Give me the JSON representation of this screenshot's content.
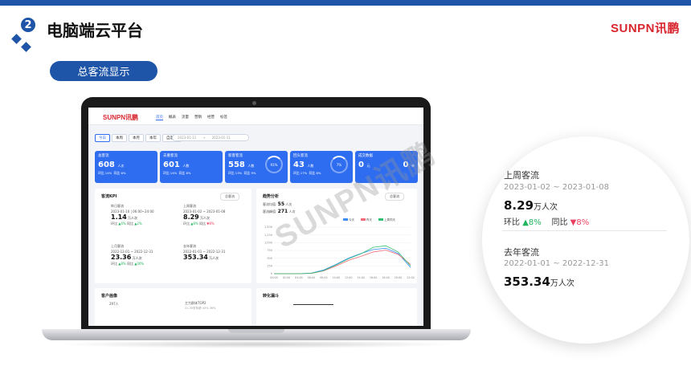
{
  "header": {
    "section_number": "2",
    "title": "电脑端云平台",
    "brand": "SUNPN讯鹏"
  },
  "section_pill": "总客流显示",
  "app": {
    "logo": "SUNPN讯鹏",
    "nav": [
      "首页",
      "概表",
      "流量",
      "营销",
      "经营",
      "标签"
    ],
    "filters": [
      "今日",
      "本周",
      "本月",
      "本年",
      "自定义"
    ],
    "date_range": {
      "start": "2023-01-11",
      "end": "2023-01-11"
    },
    "cards": [
      {
        "title": "总客流",
        "value": "608",
        "unit": "人次",
        "huanbi": "环比 14%",
        "tongbi": "同比 6%"
      },
      {
        "title": "去重客流",
        "value": "601",
        "unit": "人数",
        "huanbi": "环比 14%",
        "tongbi": "同比 8%"
      },
      {
        "title": "新客客流",
        "value": "558",
        "unit": "人数",
        "ring": "91%",
        "huanbi": "环比 13%",
        "tongbi": "同比 9%"
      },
      {
        "title": "回头客流",
        "value": "43",
        "unit": "人数",
        "ring": "7%",
        "huanbi": "环比 17%",
        "tongbi": "同比 8%"
      },
      {
        "title": "成交数据",
        "value": "0",
        "unit": "元",
        "value2": "0",
        "unit2": "单"
      }
    ],
    "kpi": {
      "title": "客流KPI",
      "select": "总客流",
      "blocks": [
        {
          "label": "昨日客流",
          "date": "2023-01-10 | 06:00~24:00",
          "value": "1.14",
          "unit": "万人次",
          "huanbi": "▲4%",
          "tongbi": "▲2%"
        },
        {
          "label": "上周客流",
          "date": "2023-01-02 ~ 2023-01-08",
          "value": "8.29",
          "unit": "万人次",
          "huanbi": "▲8%",
          "tongbi": "▼8%"
        },
        {
          "label": "上月客流",
          "date": "2022-12-01 ~ 2022-12-31",
          "value": "23.36",
          "unit": "万人次",
          "huanbi": "▲8%",
          "tongbi": "▲00%"
        },
        {
          "label": "去年客流",
          "date": "2022-01-01 ~ 2022-12-31",
          "value": "353.34",
          "unit": "万人次"
        }
      ]
    },
    "trend": {
      "title": "趋势分析",
      "select": "总客流",
      "stat1_label": "客流均值:",
      "stat1_value": "55",
      "stat1_unit": "人次",
      "stat2_label": "客流峰值:",
      "stat2_value": "271",
      "stat2_unit": "人次",
      "legend": [
        "今天",
        "昨天",
        "上周同天"
      ],
      "colors": [
        "#3a8ef5",
        "#f06a78",
        "#2fbf71"
      ]
    },
    "bottom": {
      "portrait": "客户画像",
      "portrait_value": "297人",
      "top2": "主力群体TOP2",
      "top2_sub": "21-30岁年龄 43% 36%",
      "convert": "转化漏斗"
    }
  },
  "chart_data": {
    "type": "line",
    "x": [
      "00:00",
      "02:00",
      "04:00",
      "06:00",
      "08:00",
      "10:00",
      "12:00",
      "14:00",
      "16:00",
      "18:00",
      "20:00",
      "22:00"
    ],
    "ylim": [
      0,
      1500
    ],
    "yticks": [
      "0",
      "250",
      "500",
      "750",
      "1,000",
      "1,250",
      "1,500"
    ],
    "series": [
      {
        "name": "今天",
        "values": [
          0,
          0,
          0,
          20,
          120,
          300,
          500,
          650,
          780,
          820,
          650,
          200
        ]
      },
      {
        "name": "昨天",
        "values": [
          0,
          0,
          0,
          10,
          90,
          250,
          430,
          560,
          700,
          760,
          620,
          300
        ]
      },
      {
        "name": "上周同天",
        "values": [
          0,
          0,
          0,
          15,
          100,
          280,
          480,
          640,
          850,
          900,
          700,
          250
        ]
      }
    ]
  },
  "magnifier": {
    "title1": "上周客流",
    "date1": "2023-01-02 ~ 2023-01-08",
    "value1": "8.29",
    "unit1": "万人次",
    "huanbi_label": "环比",
    "huanbi_value": "▲8%",
    "tongbi_label": "同比",
    "tongbi_value": "▼8%",
    "title2": "去年客流",
    "date2": "2022-01-01 ~ 2022-12-31",
    "value2": "353.34",
    "unit2": "万人次"
  },
  "watermark": "SUNPN讯鹏"
}
